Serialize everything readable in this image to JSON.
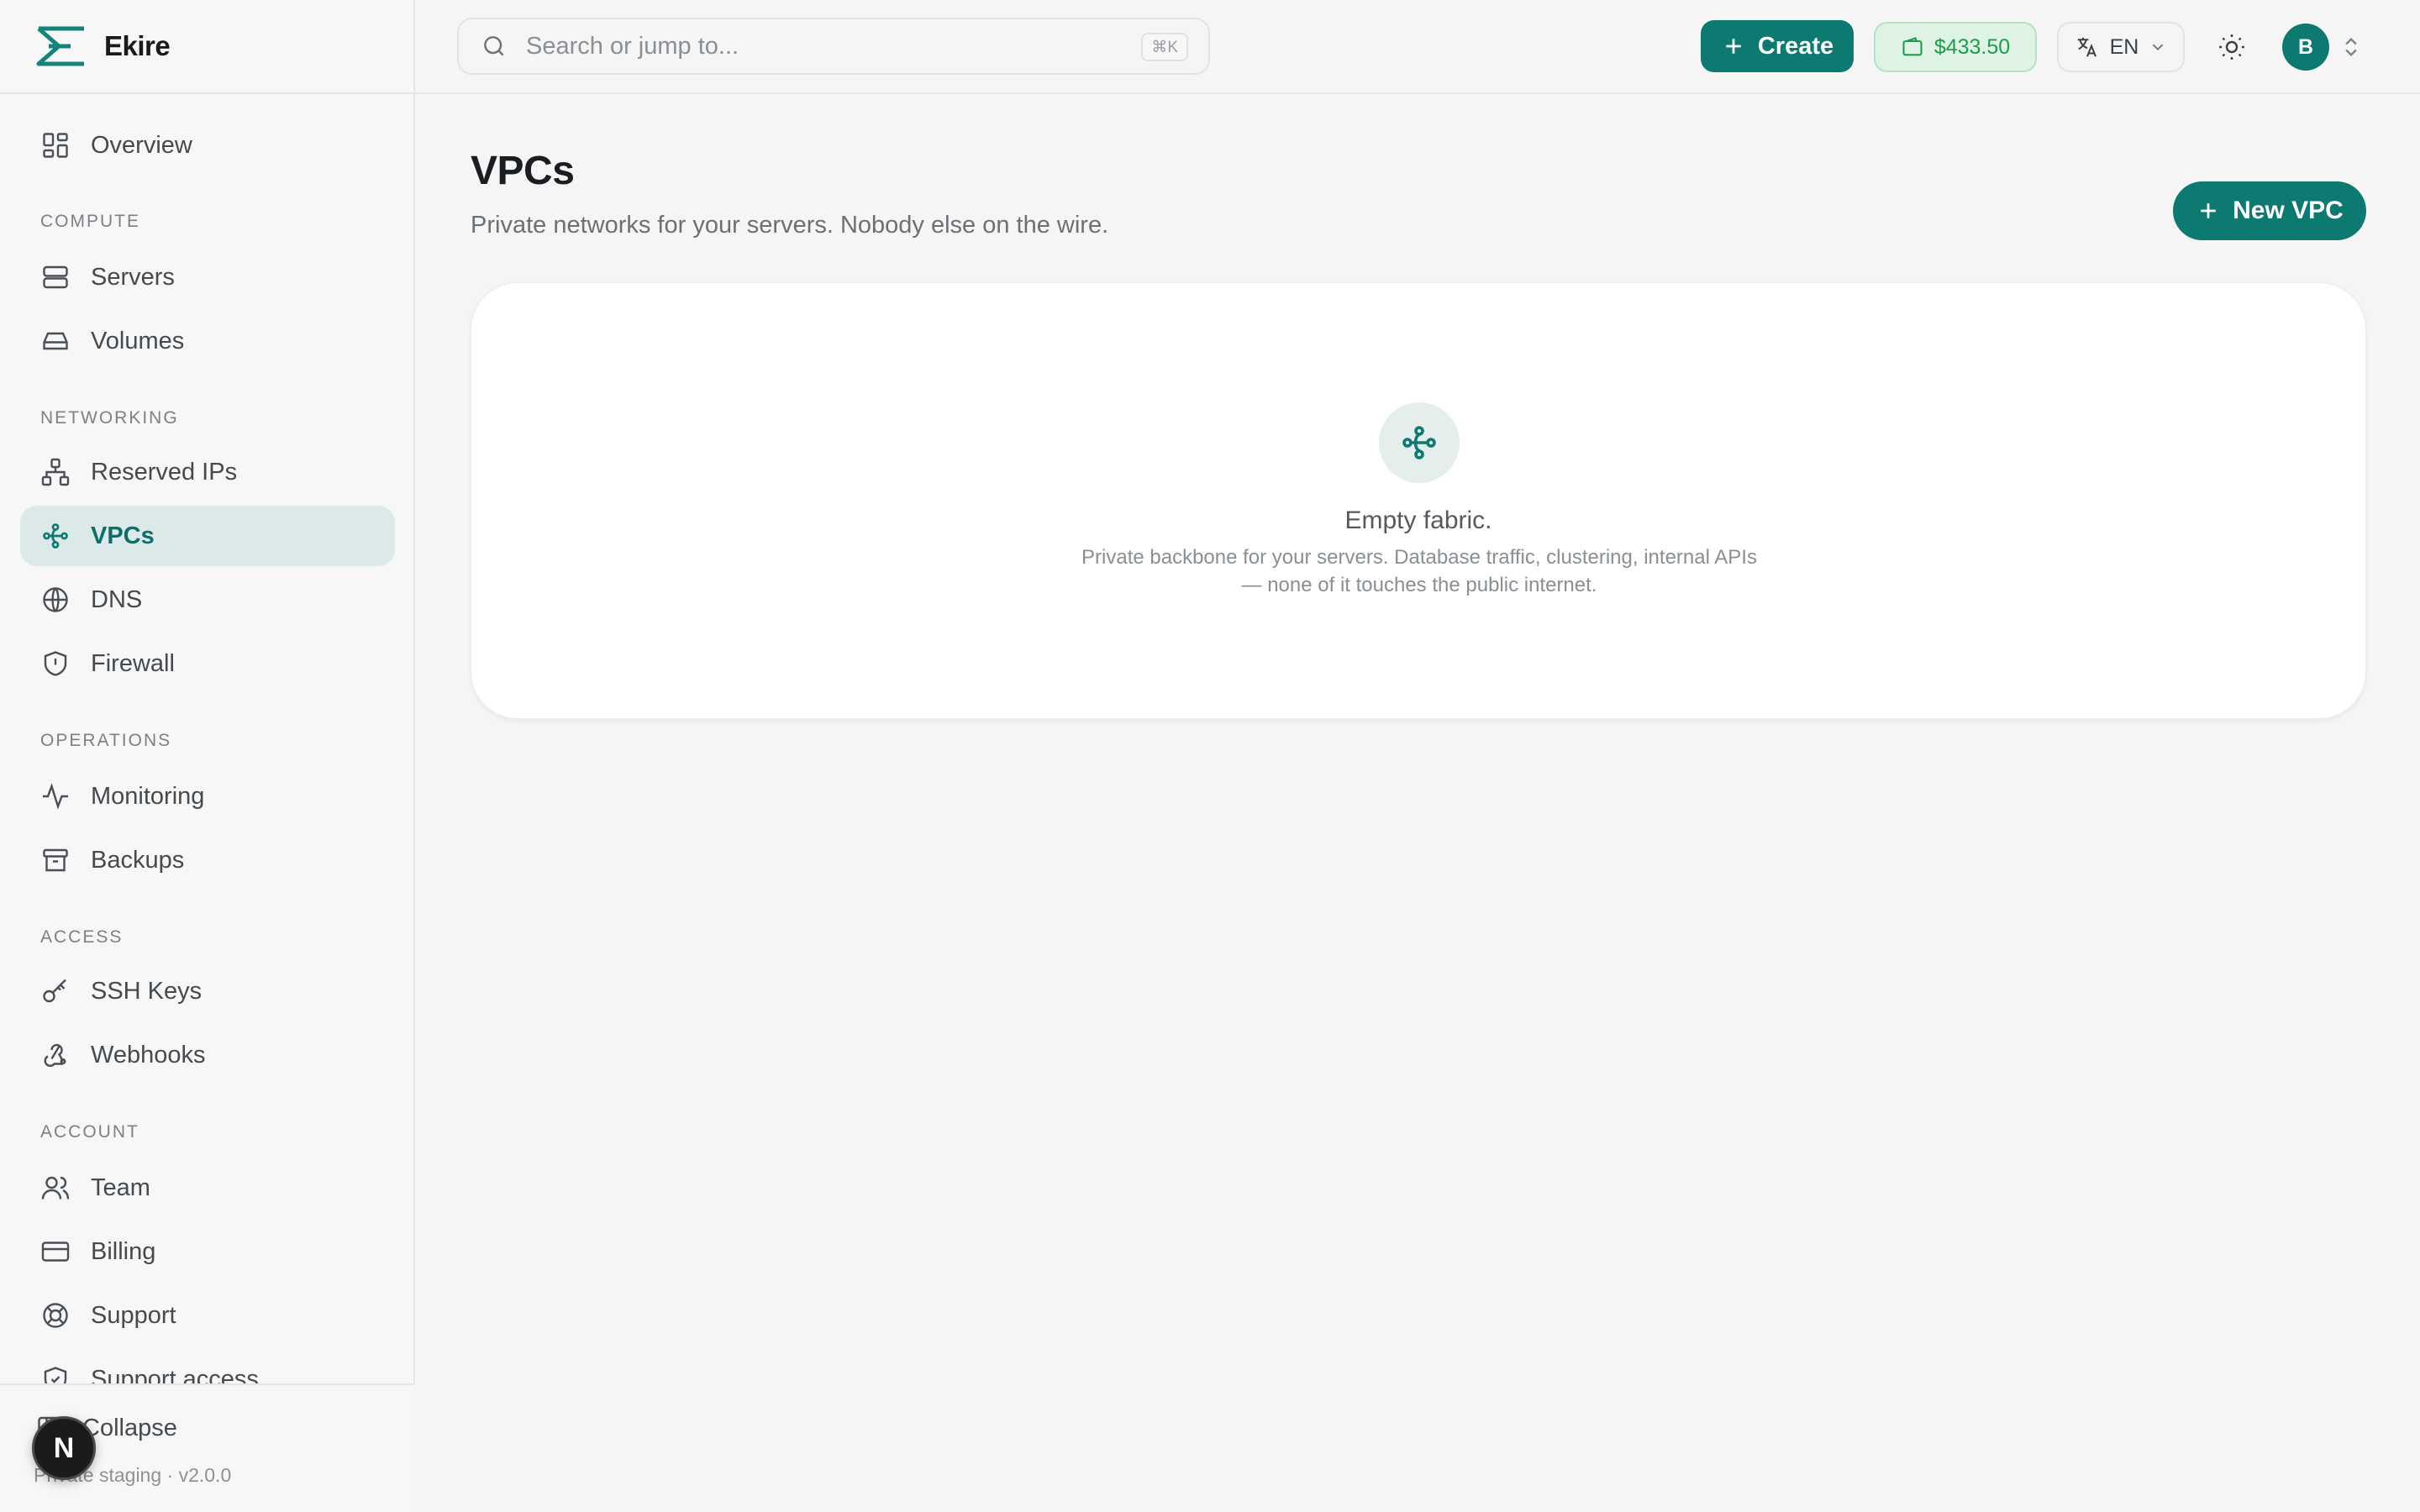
{
  "brand": {
    "name": "Ekire",
    "logo_icon": "ekire-logo"
  },
  "sidebar": {
    "items": [
      {
        "label": "Overview",
        "icon": "grid-icon"
      },
      {
        "section": "COMPUTE"
      },
      {
        "label": "Servers",
        "icon": "server-icon"
      },
      {
        "label": "Volumes",
        "icon": "drive-icon"
      },
      {
        "section": "NETWORKING"
      },
      {
        "label": "Reserved IPs",
        "icon": "network-icon"
      },
      {
        "label": "VPCs",
        "icon": "vpc-icon",
        "active": true
      },
      {
        "label": "DNS",
        "icon": "globe-icon"
      },
      {
        "label": "Firewall",
        "icon": "shield-icon"
      },
      {
        "section": "OPERATIONS"
      },
      {
        "label": "Monitoring",
        "icon": "activity-icon"
      },
      {
        "label": "Backups",
        "icon": "archive-icon"
      },
      {
        "section": "ACCESS"
      },
      {
        "label": "SSH Keys",
        "icon": "key-icon"
      },
      {
        "label": "Webhooks",
        "icon": "webhook-icon"
      },
      {
        "section": "ACCOUNT"
      },
      {
        "label": "Team",
        "icon": "users-icon"
      },
      {
        "label": "Billing",
        "icon": "credit-card-icon"
      },
      {
        "label": "Support",
        "icon": "lifebuoy-icon"
      },
      {
        "label": "Support access",
        "icon": "shield-check-icon"
      }
    ],
    "collapse_label": "Collapse",
    "version": "Private staging · v2.0.0",
    "dev_badge": "N"
  },
  "topbar": {
    "search_placeholder": "Search or jump to...",
    "search_shortcut": "⌘K",
    "create_label": "Create",
    "balance": "$433.50",
    "language": "EN",
    "avatar_initial": "B"
  },
  "main": {
    "title": "VPCs",
    "subtitle": "Private networks for your servers. Nobody else on the wire.",
    "new_button": "New VPC",
    "empty_title": "Empty fabric.",
    "empty_description": "Private backbone for your servers. Database traffic, clustering, internal APIs — none of it touches the public internet."
  },
  "colors": {
    "accent": "#0d7a72",
    "active_bg": "#dbe9e8",
    "balance_text": "#1b9d4b",
    "balance_bg": "#dff3e4"
  }
}
